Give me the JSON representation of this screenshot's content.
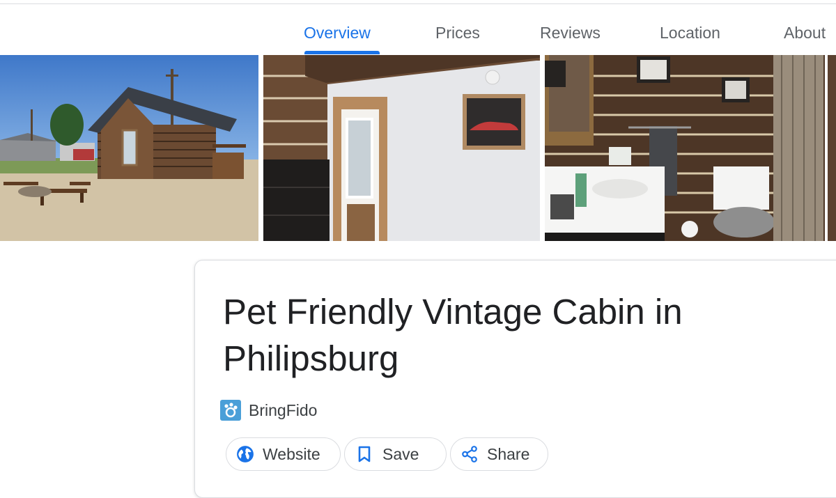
{
  "tabs": [
    {
      "label": "Overview",
      "active": true
    },
    {
      "label": "Prices"
    },
    {
      "label": "Reviews"
    },
    {
      "label": "Location"
    },
    {
      "label": "About"
    }
  ],
  "gallery": {
    "photos": [
      {
        "name": "Cabin exterior"
      },
      {
        "name": "Cabin interior"
      },
      {
        "name": "Cabin bathroom"
      }
    ]
  },
  "listing": {
    "title_line1": "Pet Friendly Vintage Cabin in",
    "title_line2": "Philipsburg",
    "source": "BringFido"
  },
  "actions": {
    "website": "Website",
    "save": "Save",
    "share": "Share"
  },
  "colors": {
    "accent": "#1a73e8",
    "text": "#202124",
    "muted": "#5f6368",
    "border": "#dadce0",
    "source_icon_bg": "#4a9fd8"
  },
  "icons": {
    "website": "globe-icon",
    "save": "bookmark-icon",
    "share": "share-icon",
    "source": "paw-icon"
  }
}
